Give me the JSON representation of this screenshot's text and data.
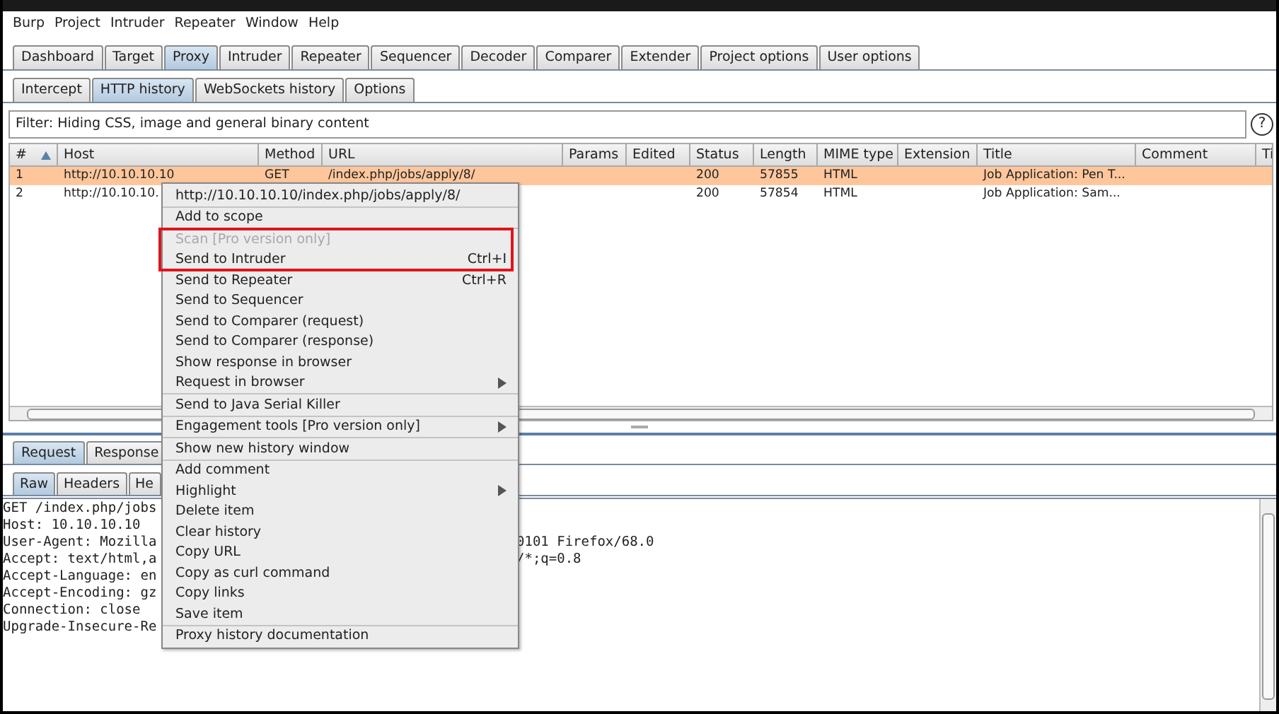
{
  "menu_bar": [
    "Burp",
    "Project",
    "Intruder",
    "Repeater",
    "Window",
    "Help"
  ],
  "main_tabs": [
    {
      "label": "Dashboard",
      "selected": false
    },
    {
      "label": "Target",
      "selected": false
    },
    {
      "label": "Proxy",
      "selected": true
    },
    {
      "label": "Intruder",
      "selected": false
    },
    {
      "label": "Repeater",
      "selected": false
    },
    {
      "label": "Sequencer",
      "selected": false
    },
    {
      "label": "Decoder",
      "selected": false
    },
    {
      "label": "Comparer",
      "selected": false
    },
    {
      "label": "Extender",
      "selected": false
    },
    {
      "label": "Project options",
      "selected": false
    },
    {
      "label": "User options",
      "selected": false
    }
  ],
  "proxy_tabs": [
    {
      "label": "Intercept",
      "selected": false
    },
    {
      "label": "HTTP history",
      "selected": true
    },
    {
      "label": "WebSockets history",
      "selected": false
    },
    {
      "label": "Options",
      "selected": false
    }
  ],
  "filter": {
    "text": "Filter: Hiding CSS, image and general binary content",
    "help": "?"
  },
  "table": {
    "columns": [
      {
        "label": "#",
        "sorted": true
      },
      {
        "label": "Host",
        "sorted": false
      },
      {
        "label": "Method",
        "sorted": false
      },
      {
        "label": "URL",
        "sorted": false
      },
      {
        "label": "Params",
        "sorted": false
      },
      {
        "label": "Edited",
        "sorted": false
      },
      {
        "label": "Status",
        "sorted": false
      },
      {
        "label": "Length",
        "sorted": false
      },
      {
        "label": "MIME type",
        "sorted": false
      },
      {
        "label": "Extension",
        "sorted": false
      },
      {
        "label": "Title",
        "sorted": false
      },
      {
        "label": "Comment",
        "sorted": false
      },
      {
        "label": "Ti",
        "sorted": false
      }
    ],
    "rows": [
      {
        "selected": true,
        "cells": [
          "1",
          "http://10.10.10.10",
          "GET",
          "/index.php/jobs/apply/8/",
          "",
          "",
          "200",
          "57855",
          "HTML",
          "",
          "Job Application: Pen T...",
          "",
          ""
        ]
      },
      {
        "selected": false,
        "cells": [
          "2",
          "http://10.10.10.",
          "",
          "",
          "",
          "",
          "200",
          "57854",
          "HTML",
          "",
          "Job Application: Sam...",
          "",
          ""
        ]
      }
    ]
  },
  "message_tabs": [
    {
      "label": "Request",
      "selected": true
    },
    {
      "label": "Response",
      "selected": false
    }
  ],
  "view_tabs": [
    {
      "label": "Raw",
      "selected": true
    },
    {
      "label": "Headers",
      "selected": false
    },
    {
      "label": "He",
      "selected": false
    }
  ],
  "request_lines": [
    {
      "left": "GET /index.php/jobs"
    },
    {
      "left": "Host: 10.10.10.10"
    },
    {
      "left": "User-Agent: Mozilla",
      "right": "0101 Firefox/68.0"
    },
    {
      "left": "Accept: text/html,a",
      "right": "/*;q=0.8"
    },
    {
      "left": "Accept-Language: en"
    },
    {
      "left": "Accept-Encoding: gz"
    },
    {
      "left": "Connection: close"
    },
    {
      "left": "Upgrade-Insecure-Re"
    }
  ],
  "context_menu": {
    "groups": [
      [
        {
          "label": "http://10.10.10.10/index.php/jobs/apply/8/",
          "disabled": false,
          "boxed": false
        }
      ],
      [
        {
          "label": "Add to scope",
          "disabled": false,
          "boxed": false
        }
      ],
      [
        {
          "label": "Scan [Pro version only]",
          "disabled": true,
          "boxed": true
        },
        {
          "label": "Send to Intruder",
          "shortcut": "Ctrl+I",
          "disabled": false,
          "boxed": true
        },
        {
          "label": "Send to Repeater",
          "shortcut": "Ctrl+R",
          "disabled": false,
          "boxed": false
        },
        {
          "label": "Send to Sequencer",
          "disabled": false,
          "boxed": false
        },
        {
          "label": "Send to Comparer (request)",
          "disabled": false,
          "boxed": false
        },
        {
          "label": "Send to Comparer (response)",
          "disabled": false,
          "boxed": false
        },
        {
          "label": "Show response in browser",
          "disabled": false,
          "boxed": false
        },
        {
          "label": "Request in browser",
          "submenu": true,
          "disabled": false,
          "boxed": false
        }
      ],
      [
        {
          "label": "Send to Java Serial Killer",
          "disabled": false,
          "boxed": false
        }
      ],
      [
        {
          "label": "Engagement tools [Pro version only]",
          "submenu": true,
          "disabled": false,
          "boxed": false
        }
      ],
      [
        {
          "label": "Show new history window",
          "disabled": false,
          "boxed": false
        }
      ],
      [
        {
          "label": "Add comment",
          "disabled": false,
          "boxed": false
        },
        {
          "label": "Highlight",
          "submenu": true,
          "disabled": false,
          "boxed": false
        },
        {
          "label": "Delete item",
          "disabled": false,
          "boxed": false
        },
        {
          "label": "Clear history",
          "disabled": false,
          "boxed": false
        },
        {
          "label": "Copy URL",
          "disabled": false,
          "boxed": false
        },
        {
          "label": "Copy as curl command",
          "disabled": false,
          "boxed": false
        },
        {
          "label": "Copy links",
          "disabled": false,
          "boxed": false
        },
        {
          "label": "Save item",
          "disabled": false,
          "boxed": false
        }
      ],
      [
        {
          "label": "Proxy history documentation",
          "disabled": false,
          "boxed": false
        }
      ]
    ]
  }
}
